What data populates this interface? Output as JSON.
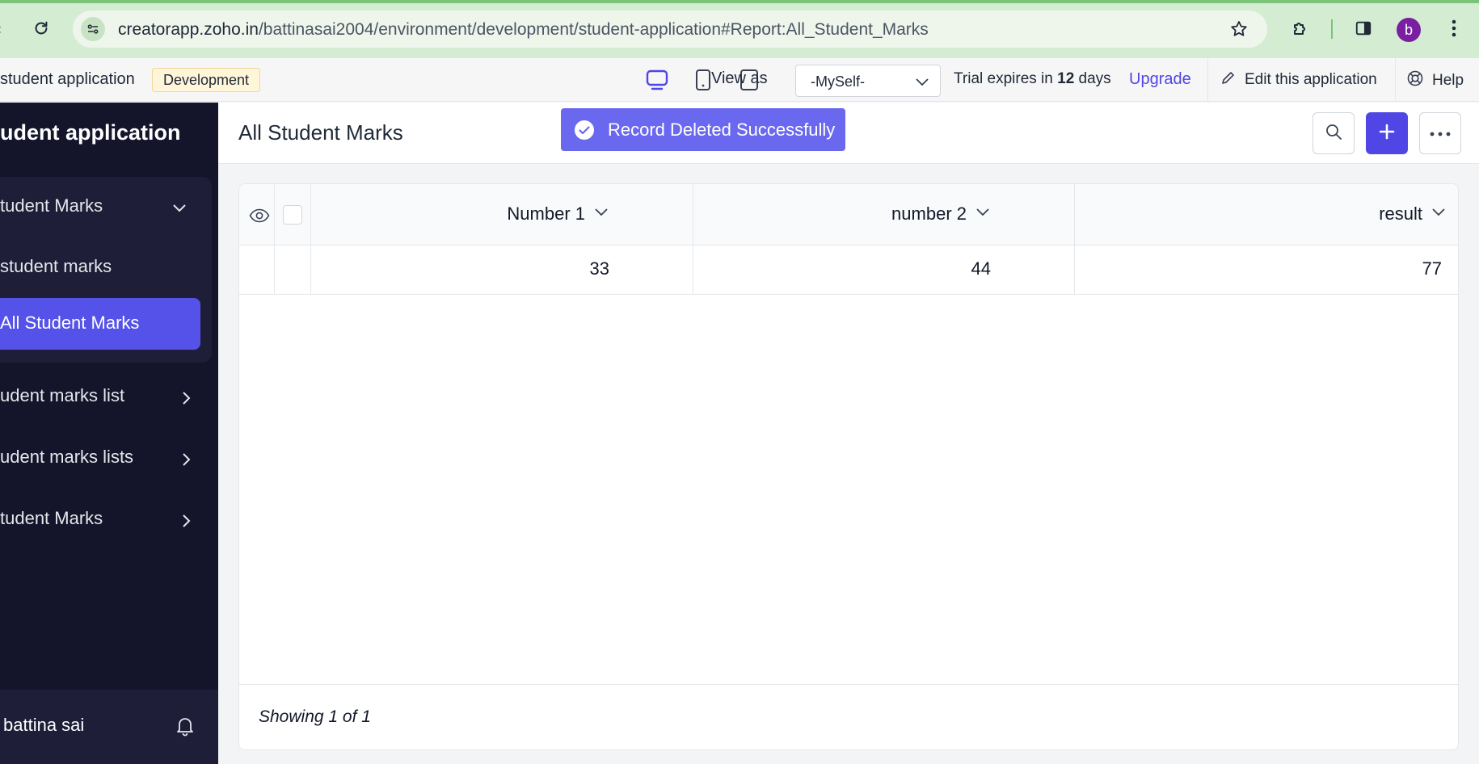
{
  "browser": {
    "url_host": "creatorapp.zoho.in",
    "url_path": "/battinasai2004/environment/development/student-application#Report:All_Student_Marks",
    "profile_initial": "b",
    "icons": [
      "back-arrow-icon",
      "reload-icon",
      "site-info-icon",
      "star-icon",
      "extensions-icon",
      "side-panel-icon",
      "kebab-menu-icon"
    ]
  },
  "header": {
    "app_name": "student application",
    "environment": "Development",
    "view_as_label": "View as",
    "view_as_value": "-MySelf-",
    "trial_prefix": "Trial expires in",
    "trial_days": "12",
    "trial_suffix": "days",
    "upgrade": "Upgrade",
    "edit_app": "Edit this application",
    "help": "Help"
  },
  "sidebar": {
    "title": "udent application",
    "group_label": "tudent Marks",
    "items": [
      {
        "label": "student marks"
      },
      {
        "label": "All Student Marks",
        "active": true
      }
    ],
    "sections": [
      {
        "label": "udent marks list"
      },
      {
        "label": "udent marks lists"
      },
      {
        "label": "tudent Marks"
      }
    ],
    "user": "battina sai"
  },
  "main": {
    "title": "All Student Marks",
    "toast": "Record Deleted Successfully",
    "columns": [
      "Number 1",
      "number 2",
      "result"
    ],
    "rows": [
      [
        "33",
        "44",
        "77"
      ]
    ],
    "footer": "Showing 1 of 1"
  },
  "colors": {
    "accent": "#4f46e5",
    "toast": "#6b68f0",
    "sidebar_bg": "#14142b",
    "sidebar_active": "#5452e8",
    "browser_bar": "#d4ecd1",
    "env_badge": "#fff5d9"
  }
}
